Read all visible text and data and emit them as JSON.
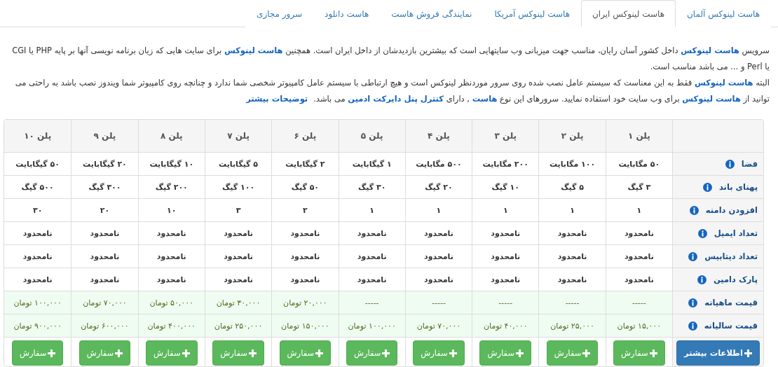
{
  "tabs": [
    {
      "label": "هاست لینوکس آلمان",
      "selected": false
    },
    {
      "label": "هاست لینوکس ایران",
      "selected": true
    },
    {
      "label": "هاست لینوکس آمریکا",
      "selected": false
    },
    {
      "label": "نمایندگی فروش هاست",
      "selected": false
    },
    {
      "label": "هاست دانلود",
      "selected": false
    },
    {
      "label": "سرور مجازی",
      "selected": false
    }
  ],
  "intro": {
    "paragraphs": [
      "سرویس **هاست لینوکس** داخل کشور آسان رایان، مناسب جهت میزبانی وب سایتهایی است که بیشترین بازدیدشان از داخل ایران است. همچنین **هاست لینوکس** برای سایت هایی که زبان برنامه نویسی آنها بر پایه PHP یا CGI یا Perl و ... می باشد مناسب است.",
      "البته **هاست لینوکس** فقط به این معناست که سیستم عامل نصب شده روی سرور موردنظر لینوکس است و هیچ ارتباطی با سیستم عامل کامپیوتر شخصی شما ندارد و چنانچه روی کامپیوتر شما ویندوز نصب باشد به راحتی می توانید از **هاست لینوکس** برای وب سایت خود استفاده نمایید. سرورهای این نوع **هاست** , دارای **کنترل پنل دایرکت ادمین** می باشد."
    ],
    "link": "توضیحات بیشتر"
  },
  "table": {
    "plans": [
      "پلن ۱",
      "پلن ۲",
      "پلن ۳",
      "پلن ۴",
      "پلن ۵",
      "پلن ۶",
      "پلن ۷",
      "پلن ۸",
      "پلن ۹",
      "پلن ۱۰"
    ],
    "rows": [
      {
        "kind": "feature",
        "label": "فضا",
        "values": [
          "۵۰ مگابایت",
          "۱۰۰ مگابایت",
          "۲۰۰ مگابایت",
          "۵۰۰ مگابایت",
          "۱ گیگابایت",
          "۲ گیگابایت",
          "۵ گیگابایت",
          "۱۰ گیگابایت",
          "۲۰ گیگابایت",
          "۵۰ گیگابایت"
        ]
      },
      {
        "kind": "feature",
        "label": "پهنای باند",
        "values": [
          "۳ گیگ",
          "۵ گیگ",
          "۱۰ گیگ",
          "۲۰ گیگ",
          "۳۰ گیگ",
          "۵۰ گیگ",
          "۱۰۰ گیگ",
          "۲۰۰ گیگ",
          "۳۰۰ گیگ",
          "۵۰۰ گیگ"
        ]
      },
      {
        "kind": "feature",
        "label": "افزودن دامنه",
        "values": [
          "۱",
          "۱",
          "۱",
          "۱",
          "۱",
          "۲",
          "۳",
          "۱۰",
          "۲۰",
          "۳۰"
        ]
      },
      {
        "kind": "feature",
        "label": "تعداد ایمیل",
        "values": [
          "نامحدود",
          "نامحدود",
          "نامحدود",
          "نامحدود",
          "نامحدود",
          "نامحدود",
          "نامحدود",
          "نامحدود",
          "نامحدود",
          "نامحدود"
        ]
      },
      {
        "kind": "feature",
        "label": "تعداد دیتابیس",
        "values": [
          "نامحدود",
          "نامحدود",
          "نامحدود",
          "نامحدود",
          "نامحدود",
          "نامحدود",
          "نامحدود",
          "نامحدود",
          "نامحدود",
          "نامحدود"
        ]
      },
      {
        "kind": "feature",
        "label": "پارک دامین",
        "values": [
          "نامحدود",
          "نامحدود",
          "نامحدود",
          "نامحدود",
          "نامحدود",
          "نامحدود",
          "نامحدود",
          "نامحدود",
          "نامحدود",
          "نامحدود"
        ]
      },
      {
        "kind": "price",
        "label": "قیمت ماهیانه",
        "values": [
          "-----",
          "-----",
          "-----",
          "-----",
          "-----",
          "۲۰,۰۰۰ تومان",
          "۳۰,۰۰۰ تومان",
          "۵۰,۰۰۰ تومان",
          "۷۰,۰۰۰ تومان",
          "۱۰۰,۰۰۰ تومان"
        ]
      },
      {
        "kind": "price",
        "label": "قیمت سالیانه",
        "values": [
          "۱۵,۰۰۰ تومان",
          "۲۵,۰۰۰ تومان",
          "۴۰,۰۰۰ تومان",
          "۷۰,۰۰۰ تومان",
          "۱۰۰,۰۰۰ تومان",
          "۱۵۰,۰۰۰ تومان",
          "۲۵۰,۰۰۰ تومان",
          "۴۰۰,۰۰۰ تومان",
          "۶۰۰,۰۰۰ تومان",
          "۹۰۰,۰۰۰ تومان"
        ]
      }
    ],
    "buttons": [
      {
        "kind": "info",
        "label": "اطلاعات بیشتر"
      },
      {
        "kind": "order",
        "label": "سفارش"
      },
      {
        "kind": "order",
        "label": "سفارش"
      },
      {
        "kind": "order",
        "label": "سفارش"
      },
      {
        "kind": "order",
        "label": "سفارش"
      },
      {
        "kind": "order",
        "label": "سفارش"
      },
      {
        "kind": "order",
        "label": "سفارش"
      },
      {
        "kind": "order",
        "label": "سفارش"
      },
      {
        "kind": "order",
        "label": "سفارش"
      },
      {
        "kind": "order",
        "label": "سفارش"
      },
      {
        "kind": "order",
        "label": "سفارش"
      }
    ]
  }
}
